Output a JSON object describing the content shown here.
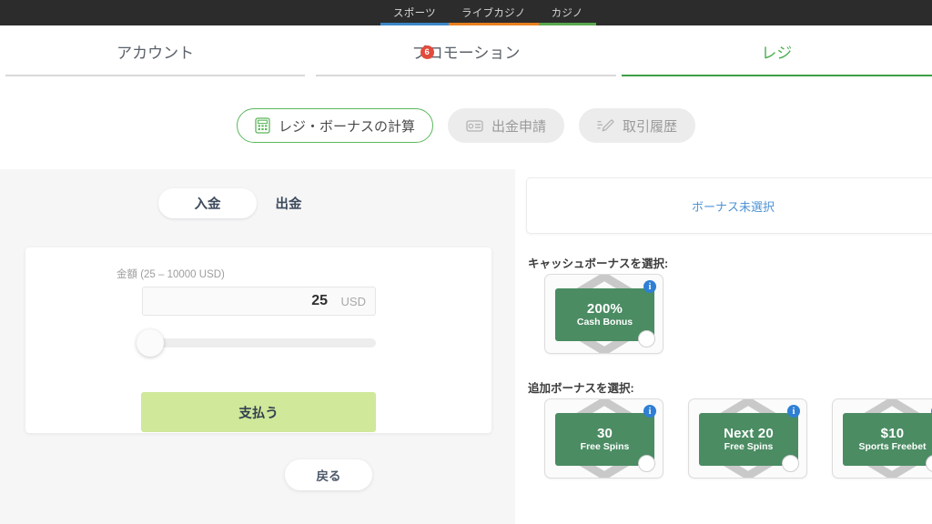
{
  "topnav": {
    "items": [
      {
        "label": "スポーツ",
        "color": "#3b87c9",
        "name": "sports"
      },
      {
        "label": "ライブカジノ",
        "color": "#e8801f",
        "name": "live"
      },
      {
        "label": "カジノ",
        "color": "#5aa84f",
        "name": "casino"
      }
    ]
  },
  "maintabs": [
    {
      "label": "アカウント",
      "badge": "",
      "active": false
    },
    {
      "label": "プロモーション",
      "badge": "6",
      "active": false
    },
    {
      "label": "レジ",
      "badge": "",
      "active": true
    }
  ],
  "pills": [
    {
      "label": "レジ・ボーナスの計算",
      "icon": "calculator-icon",
      "active": true
    },
    {
      "label": "出金申請",
      "icon": "card-icon",
      "active": false
    },
    {
      "label": "取引履歴",
      "icon": "pencil-icon",
      "active": false
    }
  ],
  "left": {
    "toggle": {
      "deposit": "入金",
      "withdraw": "出金"
    },
    "amount_label": "金額 (25 – 10000 USD)",
    "amount_value": "25",
    "amount_currency": "USD",
    "amount_placeholder": "25",
    "pay_button": "支払う",
    "back_button": "戻る",
    "slider": {
      "value": 25,
      "min": 25,
      "max": 10000,
      "percent": 0
    }
  },
  "right": {
    "bonus_status": "ボーナス未選択",
    "cash_bonus_title": "キャッシュボーナスを選択:",
    "extra_bonus_title": "追加ボーナスを選択:",
    "info_glyph": "i",
    "cash_bonuses": [
      {
        "big": "200%",
        "sub": "Cash Bonus"
      }
    ],
    "extra_bonuses": [
      {
        "big": "30",
        "sub": "Free Spins"
      },
      {
        "big": "Next 20",
        "sub": "Free Spins"
      },
      {
        "big": "$10",
        "sub": "Sports Freebet"
      }
    ]
  },
  "colors": {
    "accent_green": "#3f9e46",
    "badge_red": "#e24b3b",
    "pay_green": "#cfe89a",
    "card_green": "#4b8c63",
    "link_blue": "#4f93d4",
    "topbar": "#2c2c2c"
  }
}
